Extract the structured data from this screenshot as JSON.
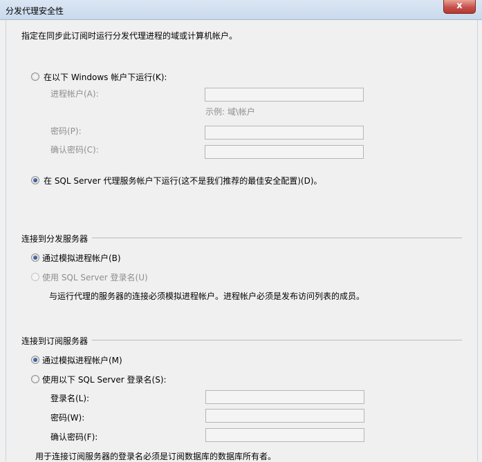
{
  "window": {
    "title": "分发代理安全性",
    "close_icon": "close-icon",
    "close_glyph": "x"
  },
  "intro": "指定在同步此订阅时运行分发代理进程的域或计算机帐户。",
  "process_account": {
    "option_windows": {
      "label": "在以下 Windows 帐户下运行(K):",
      "checked": false
    },
    "process_account_label": "进程帐户(A):",
    "process_account_value": "",
    "example": "示例: 域\\帐户",
    "password_label": "密码(P):",
    "password_value": "",
    "confirm_password_label": "确认密码(C):",
    "confirm_password_value": "",
    "option_sql_agent": {
      "label": "在 SQL Server 代理服务帐户下运行(这不是我们推荐的最佳安全配置)(D)。",
      "checked": true
    }
  },
  "distributor": {
    "heading": "连接到分发服务器",
    "option_impersonate": {
      "label": "通过模拟进程帐户(B)",
      "checked": true
    },
    "option_sql_login": {
      "label": "使用 SQL Server 登录名(U)",
      "checked": false,
      "enabled": false
    },
    "note": "与运行代理的服务器的连接必须模拟进程帐户。进程帐户必须是发布访问列表的成员。"
  },
  "subscriber": {
    "heading": "连接到订阅服务器",
    "option_impersonate": {
      "label": "通过模拟进程帐户(M)",
      "checked": true
    },
    "option_sql_login": {
      "label": "使用以下 SQL Server 登录名(S):",
      "checked": false
    },
    "login_label": "登录名(L):",
    "login_value": "",
    "password_label": "密码(W):",
    "password_value": "",
    "confirm_password_label": "确认密码(F):",
    "confirm_password_value": "",
    "note": "用于连接订阅服务器的登录名必须是订阅数据库的数据库所有者。"
  },
  "colors": {
    "accent_radio": "#1f3f7a",
    "close_button": "#c75050",
    "disabled_text": "#8e8e8e"
  }
}
